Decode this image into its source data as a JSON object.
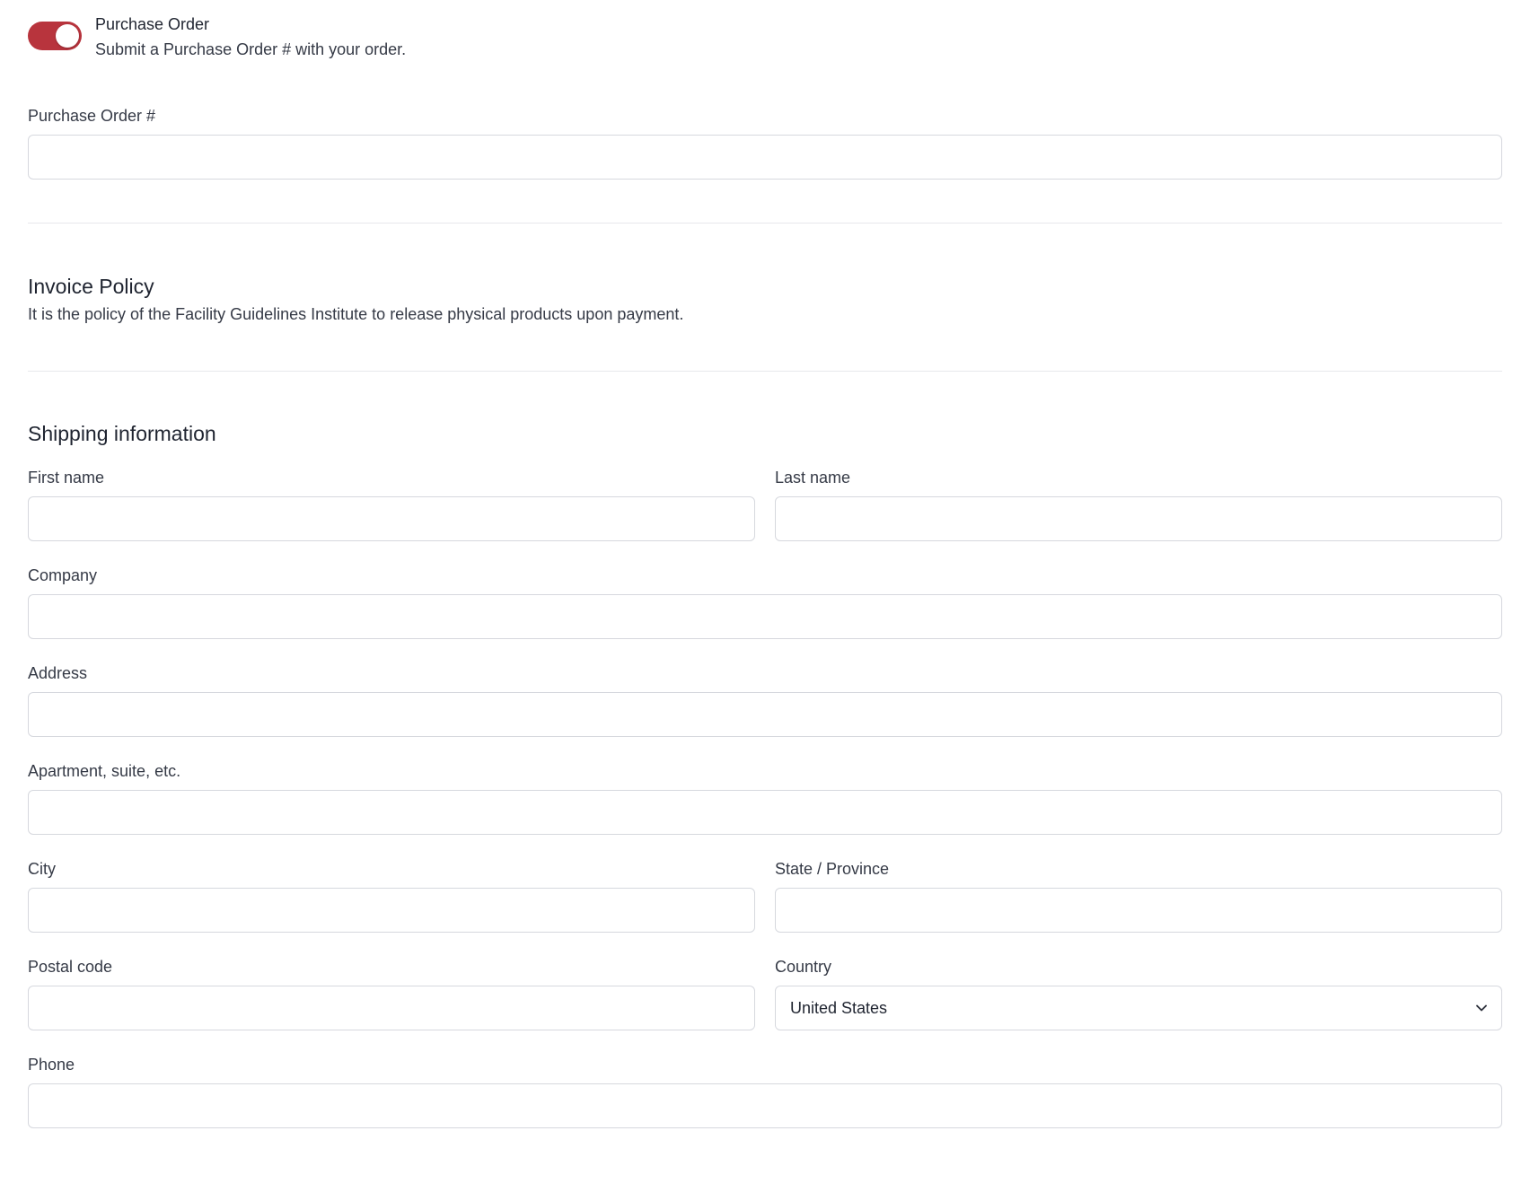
{
  "purchase_order_toggle": {
    "title": "Purchase Order",
    "description": "Submit a Purchase Order # with your order.",
    "enabled": true,
    "color": "#b8343d"
  },
  "purchase_order_field": {
    "label": "Purchase Order #",
    "value": ""
  },
  "invoice_policy": {
    "title": "Invoice Policy",
    "text": "It is the policy of the Facility Guidelines Institute to release physical products upon payment."
  },
  "shipping": {
    "title": "Shipping information",
    "first_name": {
      "label": "First name",
      "value": ""
    },
    "last_name": {
      "label": "Last name",
      "value": ""
    },
    "company": {
      "label": "Company",
      "value": ""
    },
    "address": {
      "label": "Address",
      "value": ""
    },
    "apartment": {
      "label": "Apartment, suite, etc.",
      "value": ""
    },
    "city": {
      "label": "City",
      "value": ""
    },
    "state": {
      "label": "State / Province",
      "value": ""
    },
    "postal_code": {
      "label": "Postal code",
      "value": ""
    },
    "country": {
      "label": "Country",
      "selected": "United States",
      "icon": "chevron-down-icon"
    },
    "phone": {
      "label": "Phone",
      "value": ""
    }
  }
}
